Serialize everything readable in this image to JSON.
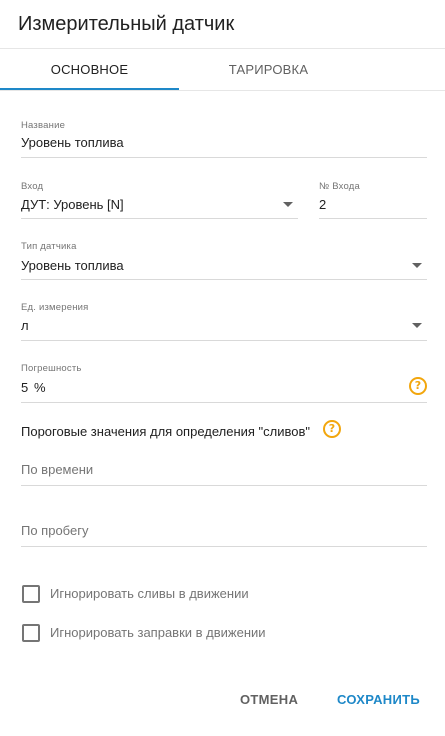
{
  "dialog": {
    "title": "Измерительный датчик"
  },
  "tabs": [
    {
      "label": "ОСНОВНОЕ",
      "active": true
    },
    {
      "label": "ТАРИРОВКА",
      "active": false
    }
  ],
  "form": {
    "name": {
      "label": "Название",
      "value": "Уровень топлива"
    },
    "input": {
      "label": "Вход",
      "value": "ДУТ: Уровень [N]"
    },
    "input_number": {
      "label": "№ Входа",
      "value": "2"
    },
    "sensor_type": {
      "label": "Тип датчика",
      "value": "Уровень топлива"
    },
    "unit": {
      "label": "Ед. измерения",
      "value": "л"
    },
    "error": {
      "label": "Погрешность",
      "value": "5",
      "unit": "%"
    }
  },
  "thresholds": {
    "title": "Пороговые значения для определения \"сливов\"",
    "by_time_placeholder": "По времени",
    "by_mileage_placeholder": "По пробегу"
  },
  "checkboxes": [
    {
      "label": "Игнорировать сливы в движении",
      "checked": false
    },
    {
      "label": "Игнорировать заправки в движении",
      "checked": false
    }
  ],
  "actions": {
    "cancel": "ОТМЕНА",
    "save": "СОХРАНИТЬ"
  },
  "colors": {
    "accent": "#1e88c8",
    "help": "#f2a60d"
  }
}
